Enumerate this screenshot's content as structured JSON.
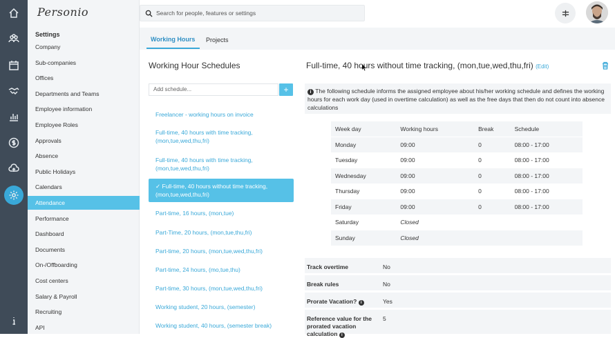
{
  "sidebar": {
    "logo": "Personio",
    "heading": "Settings",
    "items": [
      {
        "label": "Company"
      },
      {
        "label": "Sub-companies"
      },
      {
        "label": "Offices"
      },
      {
        "label": "Departments and Teams"
      },
      {
        "label": "Employee information"
      },
      {
        "label": "Employee Roles"
      },
      {
        "label": "Approvals"
      },
      {
        "label": "Absence"
      },
      {
        "label": "Public Holidays"
      },
      {
        "label": "Calendars"
      },
      {
        "label": "Attendance"
      },
      {
        "label": "Performance"
      },
      {
        "label": "Dashboard"
      },
      {
        "label": "Documents"
      },
      {
        "label": "On-/Offboarding"
      },
      {
        "label": "Cost centers"
      },
      {
        "label": "Salary & Payroll"
      },
      {
        "label": "Recruiting"
      },
      {
        "label": "API"
      }
    ],
    "active_label": "Attendance"
  },
  "iconbar": {
    "icons": [
      "home-icon",
      "people-icon",
      "calendar-icon",
      "handshake-icon",
      "chart-icon",
      "dollar-icon",
      "cloud-upload-icon",
      "gear-icon",
      "info-icon"
    ],
    "active": "gear-icon"
  },
  "search": {
    "placeholder": "Search for people, features or settings"
  },
  "tabs": [
    {
      "label": "Working Hours"
    },
    {
      "label": "Projects"
    }
  ],
  "schedules": {
    "title": "Working Hour Schedules",
    "add_placeholder": "Add schedule...",
    "add_button": "+",
    "items": [
      {
        "label": "Freelancer - working hours on invoice"
      },
      {
        "label": "Full-time, 40 hours with time tracking, (mon,tue,wed,thu,fri)"
      },
      {
        "label": "Full-time, 40 hours with time tracking, (mon,tue,wed,thu,fri)"
      },
      {
        "label": "✓ Full-time, 40 hours without time tracking, (mon,tue,wed,thu,fri)"
      },
      {
        "label": "Part-time, 16 hours, (mon,tue)"
      },
      {
        "label": "Part-Time, 20 hours, (mon,tue,thu,fri)"
      },
      {
        "label": "Part-time, 20 hours, (mon,tue,wed,thu,fri)"
      },
      {
        "label": "Part-time, 24 hours, (mo,tue,thu)"
      },
      {
        "label": "Part-time, 30 hours, (mon,tue,wed,thu,fri)"
      },
      {
        "label": "Working student, 20 hours, (semester)"
      },
      {
        "label": "Working student, 40 hours, (semester break)"
      }
    ]
  },
  "detail": {
    "title": "Full-time, 40 hours without time tracking, (mon,tue,wed,thu,fri)",
    "edit": "(Edit)",
    "info": "The following schedule informs the assigned employee about his/her working schedule and defines the working hours for each work day (used in overtime calculation) as well as the free days that then do not count into absence calculations",
    "columns": [
      "Week day",
      "Working hours",
      "Break",
      "Schedule"
    ],
    "rows": [
      {
        "day": "Monday",
        "hours": "09:00",
        "break": "0",
        "schedule": "08:00 - 17:00"
      },
      {
        "day": "Tuesday",
        "hours": "09:00",
        "break": "0",
        "schedule": "08:00 - 17:00"
      },
      {
        "day": "Wednesday",
        "hours": "09:00",
        "break": "0",
        "schedule": "08:00 - 17:00"
      },
      {
        "day": "Thursday",
        "hours": "09:00",
        "break": "0",
        "schedule": "08:00 - 17:00"
      },
      {
        "day": "Friday",
        "hours": "09:00",
        "break": "0",
        "schedule": "08:00 - 17:00"
      },
      {
        "day": "Saturday",
        "hours": "Closed",
        "break": "",
        "schedule": ""
      },
      {
        "day": "Sunday",
        "hours": "Closed",
        "break": "",
        "schedule": ""
      }
    ],
    "properties": [
      {
        "key": "Track overtime",
        "value": "No"
      },
      {
        "key": "Break rules",
        "value": "No"
      },
      {
        "key": "Prorate Vacation?",
        "value": "Yes"
      },
      {
        "key": "Reference value for the prorated vacation calculation",
        "value": "5"
      }
    ]
  },
  "colors": {
    "accent": "#56c1e7",
    "sidebar_bg": "#3f4b58",
    "link": "#39a8d8"
  }
}
